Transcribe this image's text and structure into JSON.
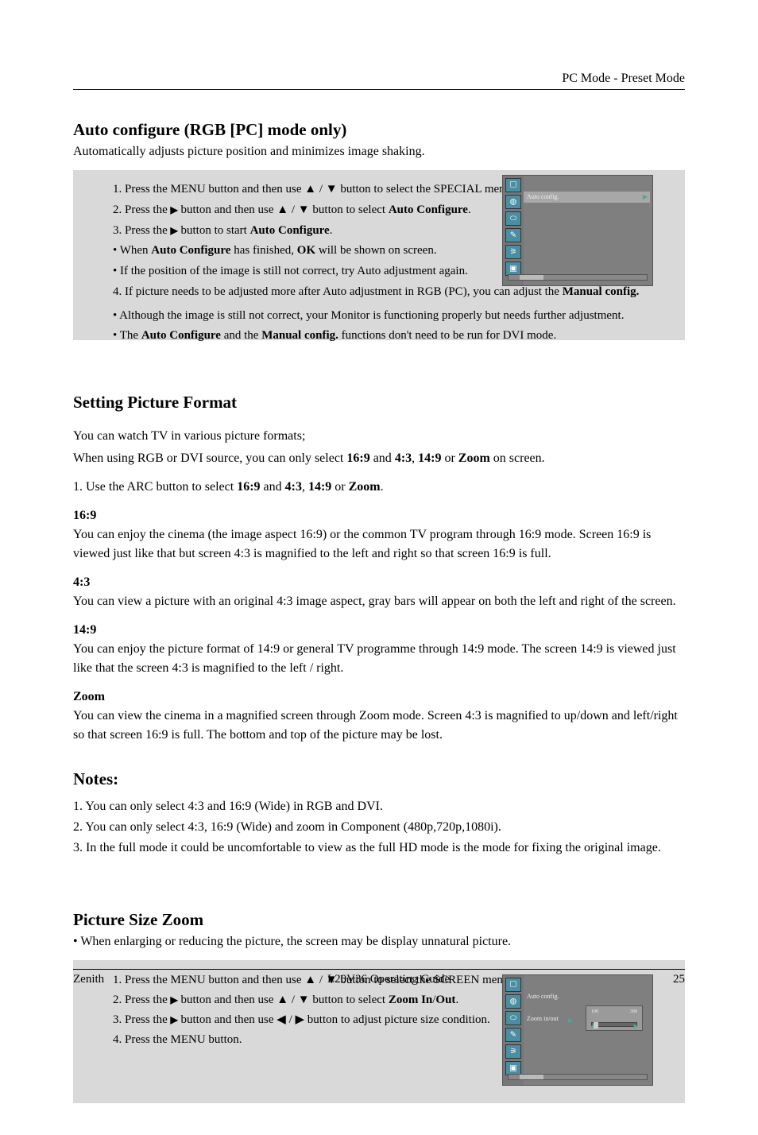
{
  "header": {
    "running": "PC Mode - Preset Mode"
  },
  "osd1": {
    "tabs": [
      "tv",
      "globe",
      "pencil",
      "slider",
      "tools",
      "pip"
    ],
    "row1": {
      "label": "Auto config.",
      "indicator": "▶"
    }
  },
  "sec1": {
    "title": "Auto configure (RGB [PC] mode only)",
    "sub": "Automatically adjusts picture position and minimizes image shaking.",
    "s1": "1. Press the MENU button and then use ▲ / ▼ button to select the SPECIAL menu.",
    "s2a": "2. Press the ",
    "s2b": " button and then use ▲ / ▼ button to select ",
    "s2_b": "Auto Configure",
    "s2c": ".",
    "s3a": "3. Press the ",
    "s3b": " button to start ",
    "s3_b": "Auto Configure",
    "s3c": ".",
    "bullet_a": "• When ",
    "bullet_b": "Auto Configure",
    "bullet_c": " has finished, ",
    "bullet_d": "OK",
    "bullet_e": " will be shown on screen.",
    "bullet2": "• If the position of the image is still not correct, try Auto adjustment again.",
    "s4a": "4. If picture needs to be adjusted more after Auto adjustment in RGB (PC), you can adjust the ",
    "s4_b": "Manual config.",
    "note_l": "• Although the image is still not correct, your Monitor is functioning properly but needs further adjustment.",
    "note2_a": "• The ",
    "note2_b": "Auto Configure",
    "note2_c": " and the ",
    "note2_d": "Manual config.",
    "note2_e": " functions don't need to be run for DVI mode."
  },
  "sec2": {
    "title": "Setting Picture Format",
    "p1": "You can watch TV in various picture formats;",
    "p2_a": "When using RGB or DVI source, you can only select ",
    "p2_169": "16:9",
    "p2_and": " and ",
    "p2_43": "4:3",
    "p2_149": "14:9",
    "p2_or": " or ",
    "p2_zoom": "Zoom",
    "p2_end": " on screen.",
    "line_a": "1. Use the ARC button to select ",
    "l_169": "16:9",
    "l_and": " and ",
    "l_43": "4:3",
    "l_149": "14:9",
    "l_or": " or ",
    "l_zoom": "Zoom",
    "l_end": ".",
    "a1": "16:9",
    "a1d": "You can enjoy the cinema (the image aspect 16:9) or the common TV program through 16:9 mode. Screen 16:9 is viewed just like that but screen 4:3 is magnified to the left and right so that screen 16:9 is full.",
    "a2": "4:3",
    "a2d": "You can view a picture with an original 4:3 image aspect, gray bars will appear on both the left and right of the screen.",
    "a3": "14:9",
    "a3d": "You can enjoy the picture format of 14:9 or general TV programme through 14:9 mode. The screen 14:9 is viewed just like that the screen 4:3 is magnified to the left / right.",
    "a4": "Zoom",
    "a4d": "You can view the cinema in a magnified screen through Zoom mode. Screen 4:3 is magnified to up/down and left/right so that screen 16:9 is full. The bottom and top of the picture may be lost.",
    "notes_h": "Notes:",
    "n1": "1. You can only select 4:3 and 16:9 (Wide) in RGB and DVI.",
    "n2": "2. You can only select 4:3, 16:9 (Wide) and zoom in Component (480p,720p,1080i).",
    "n3": "3. In the full mode it could be uncomfortable to view as the full HD mode is the mode for fixing the original image."
  },
  "sec3": {
    "title": "Picture Size Zoom",
    "sub": "•  When enlarging or reducing the picture, the screen may be display unnatural picture.",
    "s1": "1. Press the MENU button and then use ▲ / ▼ button to select the SCREEN menu.",
    "s2a": "2. Press the ",
    "s2b": " button and then use ▲ / ▼ button to select ",
    "s2_b": "Zoom In",
    "s2_slash": "/",
    "s2_b2": "Out",
    "s2c": ".",
    "s3a": "3. Press the ",
    "s3b": " button and then use ◀ / ▶ button to adjust picture size condition.",
    "s4": "4. Press the MENU button.",
    "panel": {
      "label1": "Auto config.",
      "label2": "Zoom in/out",
      "slmin": "100",
      "slmax": "300"
    }
  },
  "footer": {
    "brand": "Zenith",
    "model": "L20V36 Operating Guide",
    "pageno": "25"
  }
}
